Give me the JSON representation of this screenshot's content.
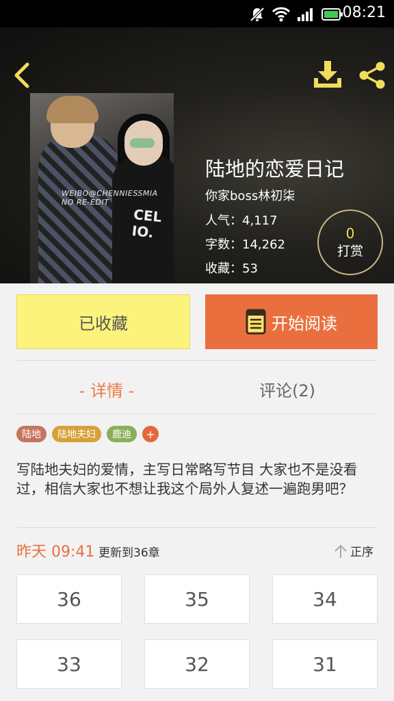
{
  "status_bar": {
    "time": "08:21",
    "icons": [
      "mute-icon",
      "wifi-icon",
      "signal-icon",
      "battery-icon"
    ]
  },
  "header": {
    "back_icon": "chevron-left-icon",
    "download_icon": "download-icon",
    "share_icon": "share-icon"
  },
  "cover": {
    "watermark_line1": "WEIBO@CHENNIESSMIA",
    "watermark_line2": "NO RE-EDIT",
    "shirt_text": "CEL IO."
  },
  "book": {
    "title": "陆地的恋爱日记",
    "author": "你家boss林初柒",
    "popularity": "人气：4,117",
    "word_count": "字数：14,262",
    "favorites": "收藏：53"
  },
  "reward": {
    "count": "0",
    "label": "打赏"
  },
  "actions": {
    "favorited_label": "已收藏",
    "start_reading_label": "开始阅读"
  },
  "tabs": {
    "detail": "- 详情 -",
    "comments": "评论(2)"
  },
  "tags": [
    {
      "label": "陆地",
      "color": "#c7745f"
    },
    {
      "label": "陆地夫妇",
      "color": "#d7a13a"
    },
    {
      "label": "鹿迪",
      "color": "#8aae5a"
    }
  ],
  "tag_add": "+",
  "synopsis": "写陆地夫妇的爱情，主写日常略写节目 大家也不是没看过，相信大家也不想让我这个局外人复述一遍跑男吧？",
  "update": {
    "time": "昨天 09:41",
    "info": "更新到36章",
    "sort_label": "正序"
  },
  "chapters": [
    "36",
    "35",
    "34",
    "33",
    "32",
    "31"
  ],
  "colors": {
    "accent_orange": "#ea6f3f",
    "favorite_yellow": "#fcf37c",
    "icon_yellow": "#f2dd5a",
    "reward_gold": "#c9b887"
  }
}
